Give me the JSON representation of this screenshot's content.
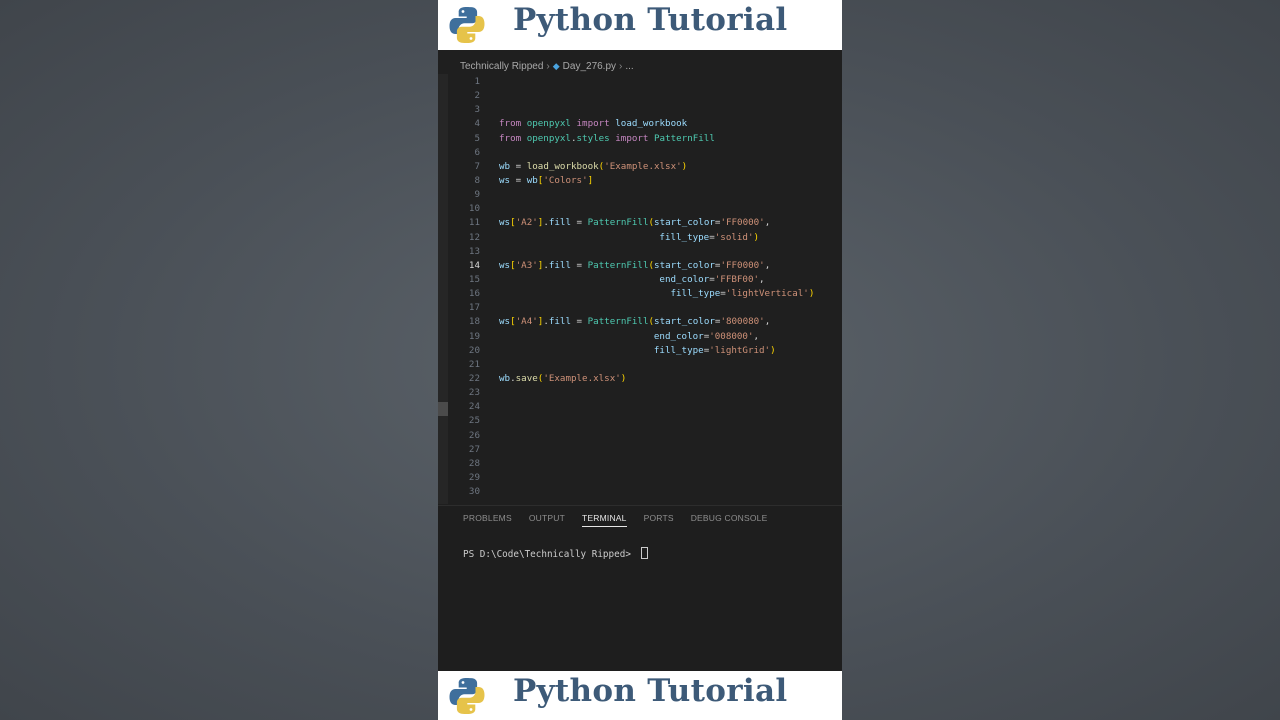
{
  "banner": {
    "title": "Python Tutorial"
  },
  "breadcrumb": {
    "folder": "Technically Ripped",
    "file": "Day_276.py",
    "trail": "..."
  },
  "editor": {
    "lines": [
      {
        "n": "1",
        "t": ""
      },
      {
        "n": "2",
        "t": ""
      },
      {
        "n": "3",
        "t": ""
      },
      {
        "n": "4",
        "t": "from openpyxl import load_workbook"
      },
      {
        "n": "5",
        "t": "from openpyxl.styles import PatternFill"
      },
      {
        "n": "6",
        "t": ""
      },
      {
        "n": "7",
        "t": "wb = load_workbook('Example.xlsx')"
      },
      {
        "n": "8",
        "t": "ws = wb['Colors']"
      },
      {
        "n": "9",
        "t": ""
      },
      {
        "n": "10",
        "t": ""
      },
      {
        "n": "11",
        "t": "ws['A2'].fill = PatternFill(start_color='FF0000',"
      },
      {
        "n": "12",
        "t": "                             fill_type='solid')"
      },
      {
        "n": "13",
        "t": ""
      },
      {
        "n": "14",
        "t": "ws['A3'].fill = PatternFill(start_color='FF0000',"
      },
      {
        "n": "15",
        "t": "                             end_color='FFBF00',"
      },
      {
        "n": "16",
        "t": "                               fill_type='lightVertical')"
      },
      {
        "n": "17",
        "t": ""
      },
      {
        "n": "18",
        "t": "ws['A4'].fill = PatternFill(start_color='800080',"
      },
      {
        "n": "19",
        "t": "                            end_color='008000',"
      },
      {
        "n": "20",
        "t": "                            fill_type='lightGrid')"
      },
      {
        "n": "21",
        "t": ""
      },
      {
        "n": "22",
        "t": "wb.save('Example.xlsx')"
      },
      {
        "n": "23",
        "t": ""
      },
      {
        "n": "24",
        "t": ""
      },
      {
        "n": "25",
        "t": ""
      },
      {
        "n": "26",
        "t": ""
      },
      {
        "n": "27",
        "t": ""
      },
      {
        "n": "28",
        "t": ""
      },
      {
        "n": "29",
        "t": ""
      },
      {
        "n": "30",
        "t": ""
      }
    ],
    "active_line": "14"
  },
  "terminal": {
    "tabs": [
      "PROBLEMS",
      "OUTPUT",
      "TERMINAL",
      "PORTS",
      "DEBUG CONSOLE"
    ],
    "active_tab": "TERMINAL",
    "prompt": "PS D:\\Code\\Technically Ripped> "
  }
}
